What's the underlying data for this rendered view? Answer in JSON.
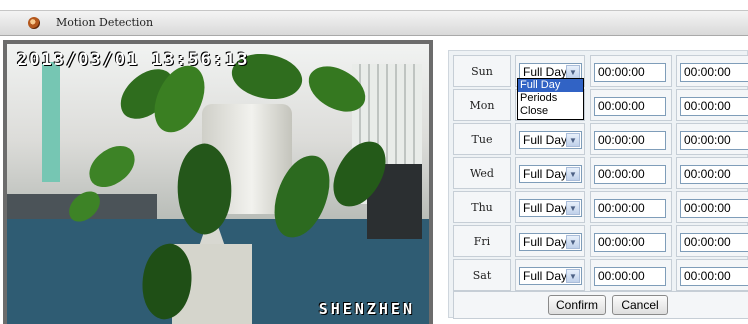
{
  "window": {
    "title": "Motion Detection"
  },
  "video": {
    "timestamp": "2013/03/01 13:56:13",
    "camera_name": "SHENZHEN"
  },
  "schedule": {
    "time_options": [
      "Full Day",
      "Periods",
      "Close"
    ],
    "rows": [
      {
        "day": "Sun",
        "mode": "Full Day",
        "start": "00:00:00",
        "end": "00:00:00"
      },
      {
        "day": "Mon",
        "mode": "Full Day",
        "start": "00:00:00",
        "end": "00:00:00"
      },
      {
        "day": "Tue",
        "mode": "Full Day",
        "start": "00:00:00",
        "end": "00:00:00"
      },
      {
        "day": "Wed",
        "mode": "Full Day",
        "start": "00:00:00",
        "end": "00:00:00"
      },
      {
        "day": "Thu",
        "mode": "Full Day",
        "start": "00:00:00",
        "end": "00:00:00"
      },
      {
        "day": "Fri",
        "mode": "Full Day",
        "start": "00:00:00",
        "end": "00:00:00"
      },
      {
        "day": "Sat",
        "mode": "Full Day",
        "start": "00:00:00",
        "end": "00:00:00"
      }
    ],
    "open_dropdown_row": 0,
    "highlighted_option": "Full Day"
  },
  "actions": {
    "confirm_label": "Confirm",
    "cancel_label": "Cancel"
  },
  "colors": {
    "selection": "#3163c5",
    "osd_text": "#ffffff"
  }
}
